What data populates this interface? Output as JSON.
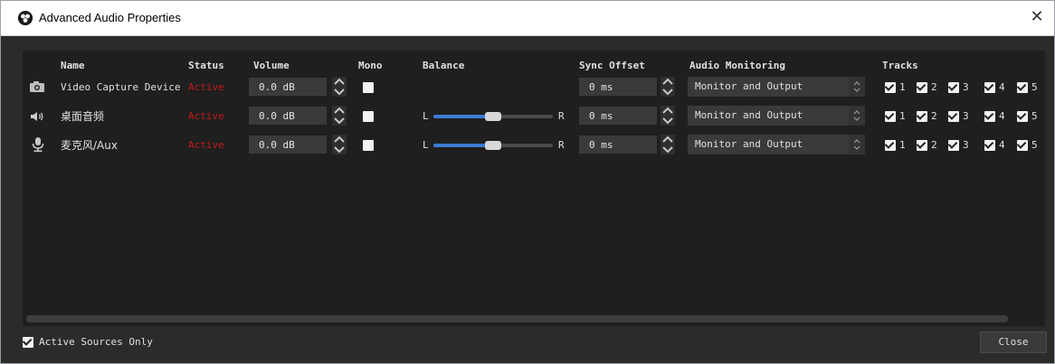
{
  "window": {
    "title": "Advanced Audio Properties",
    "close_glyph": "✕"
  },
  "columns": {
    "name": "Name",
    "status": "Status",
    "volume": "Volume",
    "mono": "Mono",
    "balance": "Balance",
    "sync_offset": "Sync Offset",
    "audio_monitoring": "Audio Monitoring",
    "tracks": "Tracks"
  },
  "rows": [
    {
      "icon": "camera-icon",
      "name": "Video Capture Device",
      "status": "Active",
      "volume": "0.0 dB",
      "mono": false,
      "balance": null,
      "sync_offset": "0 ms",
      "monitoring": "Monitor and Output",
      "tracks": [
        {
          "n": "1",
          "on": true
        },
        {
          "n": "2",
          "on": true
        },
        {
          "n": "3",
          "on": true
        },
        {
          "n": "4",
          "on": true
        },
        {
          "n": "5",
          "on": true
        }
      ]
    },
    {
      "icon": "speaker-icon",
      "name": "桌面音频",
      "status": "Active",
      "volume": "0.0 dB",
      "mono": false,
      "balance": {
        "left": "L",
        "right": "R",
        "value": 0.5
      },
      "sync_offset": "0 ms",
      "monitoring": "Monitor and Output",
      "tracks": [
        {
          "n": "1",
          "on": true
        },
        {
          "n": "2",
          "on": true
        },
        {
          "n": "3",
          "on": true
        },
        {
          "n": "4",
          "on": true
        },
        {
          "n": "5",
          "on": true
        }
      ]
    },
    {
      "icon": "microphone-icon",
      "name": "麦克风/Aux",
      "status": "Active",
      "volume": "0.0 dB",
      "mono": false,
      "balance": {
        "left": "L",
        "right": "R",
        "value": 0.5
      },
      "sync_offset": "0 ms",
      "monitoring": "Monitor and Output",
      "tracks": [
        {
          "n": "1",
          "on": true
        },
        {
          "n": "2",
          "on": true
        },
        {
          "n": "3",
          "on": true
        },
        {
          "n": "4",
          "on": true
        },
        {
          "n": "5",
          "on": true
        }
      ]
    }
  ],
  "footer": {
    "active_only_label": "Active Sources Only",
    "active_only_checked": true,
    "close_label": "Close"
  },
  "colors": {
    "status_active": "#c21a1a",
    "slider_fill": "#3b7bd4",
    "panel": "#1f1f1f",
    "window": "#2b2b2b"
  }
}
